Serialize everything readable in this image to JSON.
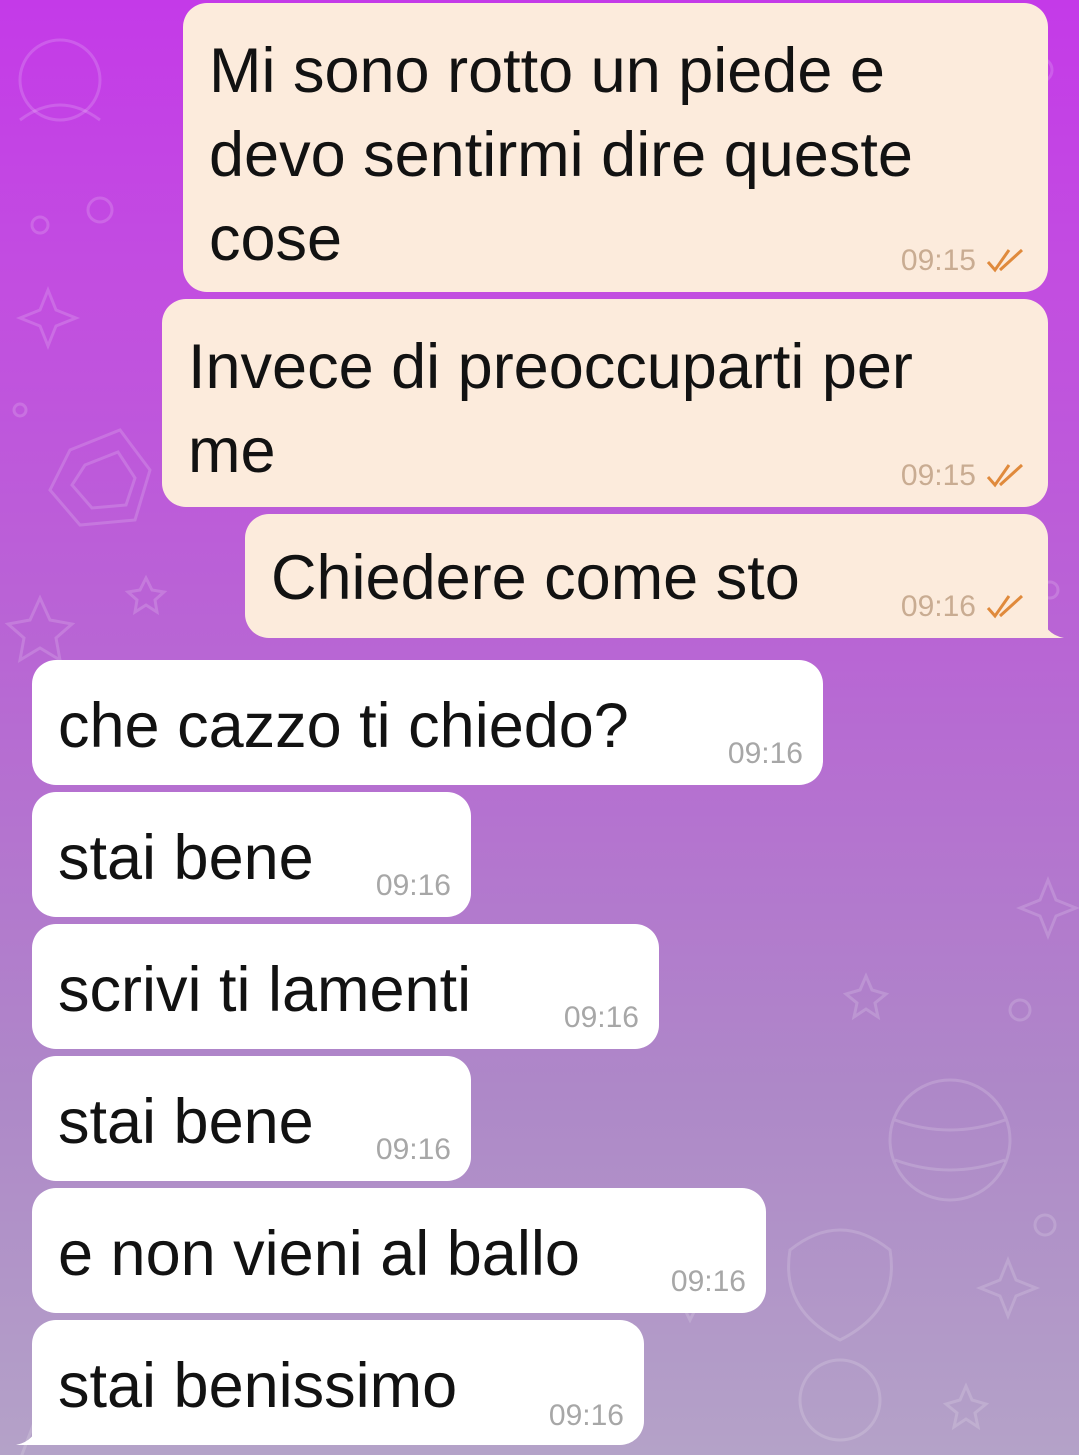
{
  "colors": {
    "outgoing_bubble": "#fcebdc",
    "incoming_bubble": "#ffffff",
    "read_check": "#e08a3c"
  },
  "messages": [
    {
      "direction": "outgoing",
      "text": "Mi sono rotto un piede e\ndevo sentirmi dire queste\ncose",
      "time": "09:15",
      "status": "read-double-check-icon"
    },
    {
      "direction": "outgoing",
      "text": "Invece di preoccuparti per\nme",
      "time": "09:15",
      "status": "read-double-check-icon"
    },
    {
      "direction": "outgoing",
      "text": "Chiedere come sto",
      "time": "09:16",
      "status": "read-double-check-icon"
    },
    {
      "direction": "incoming",
      "text": "che cazzo ti chiedo?",
      "time": "09:16"
    },
    {
      "direction": "incoming",
      "text": "stai bene",
      "time": "09:16"
    },
    {
      "direction": "incoming",
      "text": "scrivi ti lamenti",
      "time": "09:16"
    },
    {
      "direction": "incoming",
      "text": "stai bene",
      "time": "09:16"
    },
    {
      "direction": "incoming",
      "text": "e non vieni al ballo",
      "time": "09:16"
    },
    {
      "direction": "incoming",
      "text": "stai benissimo",
      "time": "09:16"
    }
  ]
}
